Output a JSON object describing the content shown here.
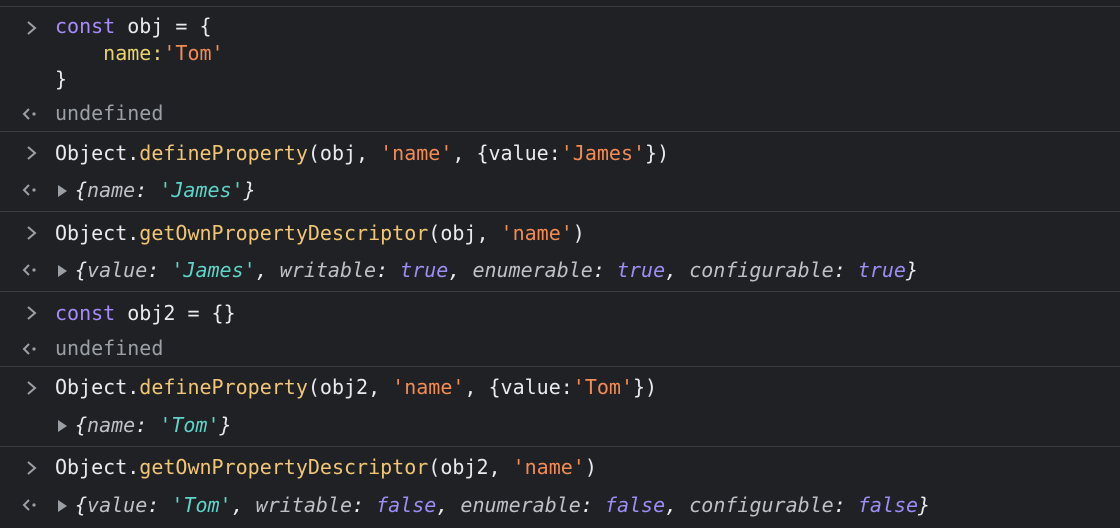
{
  "entries": [
    {
      "type": "input",
      "lines": [
        {
          "tokens": [
            "const",
            " obj = {"
          ]
        },
        {
          "tokens": [
            "    name:",
            "'Tom'"
          ]
        },
        {
          "tokens": [
            "}"
          ]
        }
      ]
    },
    {
      "type": "result",
      "text": "undefined"
    },
    {
      "type": "input",
      "tokens": [
        "Object.",
        "defineProperty",
        "(obj, ",
        "'name'",
        ", {value:",
        "'James'",
        "})"
      ]
    },
    {
      "type": "output",
      "tokens": [
        "{",
        "name",
        ": ",
        "'James'",
        "}"
      ]
    },
    {
      "type": "input",
      "tokens": [
        "Object.",
        "getOwnPropertyDescriptor",
        "(obj, ",
        "'name'",
        ")"
      ]
    },
    {
      "type": "output",
      "tokens": [
        "{",
        "value",
        ": ",
        "'James'",
        ", ",
        "writable",
        ": ",
        "true",
        ", ",
        "enumerable",
        ": ",
        "true",
        ", ",
        "configurable",
        ": ",
        "true",
        "}"
      ]
    },
    {
      "type": "input",
      "tokens": [
        "const",
        " obj2 = {}"
      ]
    },
    {
      "type": "result",
      "text": "undefined"
    },
    {
      "type": "input",
      "tokens": [
        "Object.",
        "defineProperty",
        "(obj2, ",
        "'name'",
        ", {value:",
        "'Tom'",
        "})"
      ]
    },
    {
      "type": "output",
      "tokens": [
        "{",
        "name",
        ": ",
        "'Tom'",
        "}"
      ]
    },
    {
      "type": "input",
      "tokens": [
        "Object.",
        "getOwnPropertyDescriptor",
        "(obj2, ",
        "'name'",
        ")"
      ]
    },
    {
      "type": "output",
      "tokens": [
        "{",
        "value",
        ": ",
        "'Tom'",
        ", ",
        "writable",
        ": ",
        "false",
        ", ",
        "enumerable",
        ": ",
        "false",
        ", ",
        "configurable",
        ": ",
        "false",
        "}"
      ]
    }
  ],
  "icons": {
    "prompt": "chevron-right-icon",
    "return": "return-arrow-icon",
    "expand": "expand-triangle-icon"
  },
  "colors": {
    "background": "#202124",
    "keyword": "#c792ea",
    "method": "#f0c674",
    "string": "#f28b54",
    "output_string": "#5cd5c8",
    "output_boolean": "#9e8cf6"
  }
}
